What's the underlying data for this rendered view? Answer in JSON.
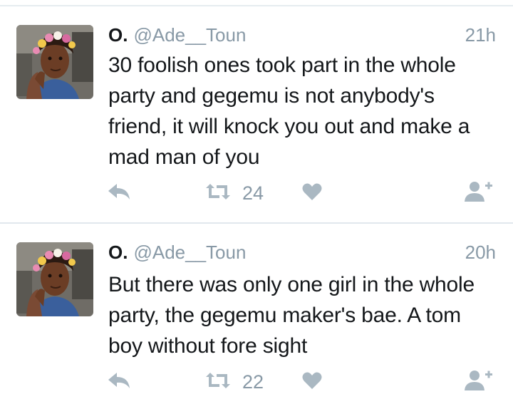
{
  "tweets": [
    {
      "author": {
        "name": "O.",
        "handle": "@Ade__Toun"
      },
      "time": "21h",
      "text": "30 foolish ones took part in the whole party and gegemu is not anybody's friend, it will knock you out and make a mad man of you",
      "retweet_count": "24",
      "icons": [
        "reply-icon",
        "retweet-icon",
        "heart-icon",
        "follow-icon"
      ]
    },
    {
      "author": {
        "name": "O.",
        "handle": "@Ade__Toun"
      },
      "time": "20h",
      "text": "But there was only one girl in the whole party, the gegemu maker's bae. A tom boy without fore sight",
      "retweet_count": "22",
      "icons": [
        "reply-icon",
        "retweet-icon",
        "heart-icon",
        "follow-icon"
      ]
    }
  ],
  "colors": {
    "text": "#14171a",
    "secondary": "#8899a6",
    "icon": "#aab8c2",
    "divider": "#e1e8ed"
  }
}
